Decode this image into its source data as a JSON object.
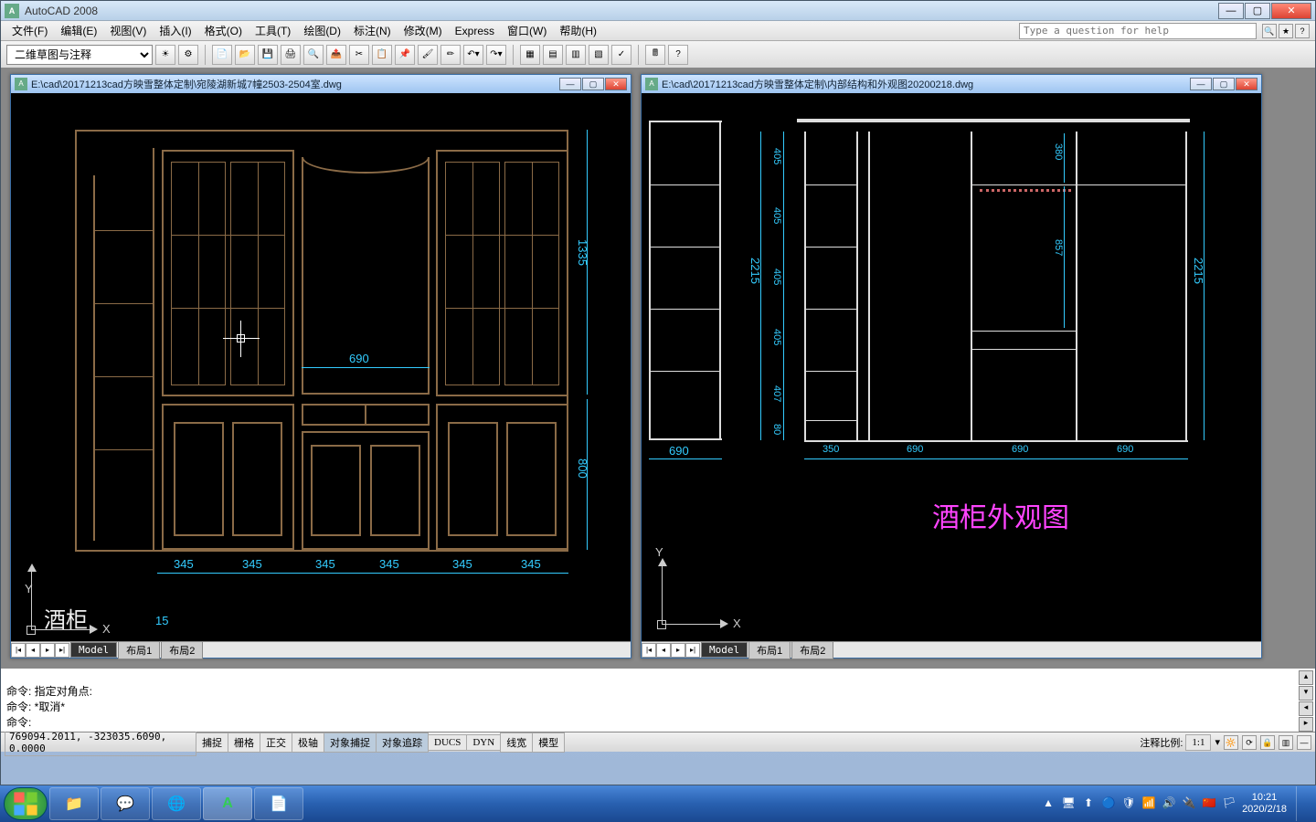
{
  "app": {
    "title": "AutoCAD 2008"
  },
  "menu": {
    "items": [
      "文件(F)",
      "编辑(E)",
      "视图(V)",
      "插入(I)",
      "格式(O)",
      "工具(T)",
      "绘图(D)",
      "标注(N)",
      "修改(M)",
      "Express",
      "窗口(W)",
      "帮助(H)"
    ],
    "help_placeholder": "Type a question for help"
  },
  "toolbar": {
    "workspace": "二维草图与注释",
    "icons_left": [
      "ws-sun-icon",
      "ws-gear-icon"
    ],
    "icons_std": [
      "new-icon",
      "open-icon",
      "save-icon",
      "plot-icon",
      "preview-icon",
      "publish-icon",
      "cut-icon",
      "copy-icon",
      "paste-icon",
      "match-icon",
      "brush-icon",
      "undo-icon",
      "redo-icon"
    ],
    "icons_right": [
      "qselect-icon",
      "designcenter-icon",
      "toolpal-icon",
      "sheetset-icon",
      "markup-icon",
      "calc-icon",
      "help-icon"
    ]
  },
  "doc1": {
    "path": "E:\\cad\\20171213cad方映雪整体定制\\宛陵湖新城7幢2503-2504室.dwg",
    "tabs": [
      "Model",
      "布局1",
      "布局2"
    ],
    "dims_bottom": [
      "345",
      "345",
      "345",
      "345",
      "345",
      "345"
    ],
    "dim_mid_w": "690",
    "dim_right_top": "1335",
    "dim_right_bot": "800",
    "dim_small": "15",
    "label_partial": "酒柜"
  },
  "doc2": {
    "path": "E:\\cad\\20171213cad方映雪整体定制\\内部结构和外观图20200218.dwg",
    "tabs": [
      "Model",
      "布局1",
      "布局2"
    ],
    "dims_left_v": [
      "405",
      "405",
      "405",
      "405",
      "407",
      "80"
    ],
    "dim_left_total": "2215",
    "dim_right_total": "2215",
    "dim_inner_top": "380",
    "dim_inner_h": "857",
    "dims_bottom_left": "690",
    "dims_bottom": [
      "350",
      "690",
      "690",
      "690"
    ],
    "title": "酒柜外观图"
  },
  "command": {
    "lines": [
      "命令: 指定对角点:",
      "命令: *取消*",
      "命令:"
    ]
  },
  "status": {
    "coords": "769094.2011, -323035.6090, 0.0000",
    "toggles": [
      {
        "label": "捕捉",
        "on": false
      },
      {
        "label": "栅格",
        "on": false
      },
      {
        "label": "正交",
        "on": false
      },
      {
        "label": "极轴",
        "on": false
      },
      {
        "label": "对象捕捉",
        "on": true
      },
      {
        "label": "对象追踪",
        "on": true
      },
      {
        "label": "DUCS",
        "on": false
      },
      {
        "label": "DYN",
        "on": false
      },
      {
        "label": "线宽",
        "on": false
      },
      {
        "label": "模型",
        "on": false
      }
    ],
    "anno_label": "注释比例:",
    "anno_scale": "1:1"
  },
  "taskbar": {
    "apps": [
      {
        "name": "explorer-icon",
        "glyph": "📁"
      },
      {
        "name": "wechat-icon",
        "glyph": "💬"
      },
      {
        "name": "browser-icon",
        "glyph": "🌐"
      },
      {
        "name": "autocad-icon",
        "glyph": "A",
        "active": true
      },
      {
        "name": "notes-icon",
        "glyph": "📄"
      }
    ],
    "tray_icons": [
      "▲",
      "🖥",
      "⬆",
      "🔵",
      "🛡",
      "📶",
      "🔊",
      "🔌",
      "🇨🇳",
      "🏳"
    ],
    "time": "10:21",
    "date": "2020/2/18"
  }
}
